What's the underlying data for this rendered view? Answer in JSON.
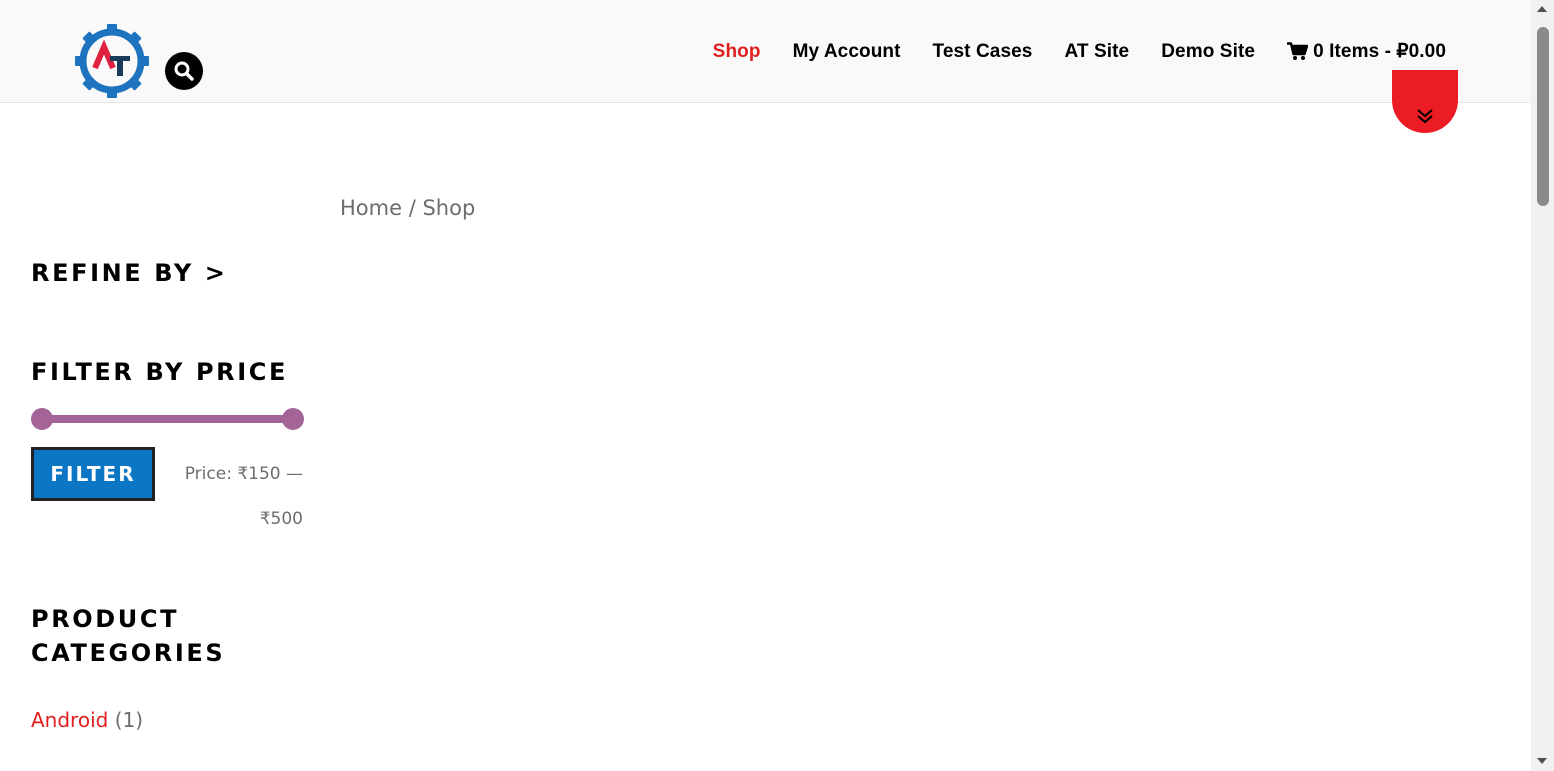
{
  "header": {
    "nav": [
      {
        "label": "Shop",
        "active": true
      },
      {
        "label": "My Account",
        "active": false
      },
      {
        "label": "Test Cases",
        "active": false
      },
      {
        "label": "AT Site",
        "active": false
      },
      {
        "label": "Demo Site",
        "active": false
      }
    ],
    "cart_label": "0 Items - ₽0.00"
  },
  "breadcrumb": {
    "home": "Home",
    "separator": " / ",
    "current": "Shop"
  },
  "sidebar": {
    "refine_title": "REFINE BY >",
    "price_title": "FILTER BY PRICE",
    "filter_button": "FILTER",
    "price_line1": "Price: ₹150 —",
    "price_line2": "₹500",
    "price_min": 150,
    "price_max": 500,
    "categories_title_line1": "PRODUCT",
    "categories_title_line2": "CATEGORIES",
    "categories": [
      {
        "name": "Android",
        "count": "(1)"
      }
    ]
  },
  "colors": {
    "accent_red": "#e02020",
    "slider_purple": "#a46497",
    "button_blue": "#0a76c4",
    "header_bg": "#f9f9f9"
  },
  "icons": {
    "logo": "at-gear-logo",
    "search": "search-icon",
    "cart": "cart-icon",
    "scroll_down": "double-chevron-down-icon"
  }
}
